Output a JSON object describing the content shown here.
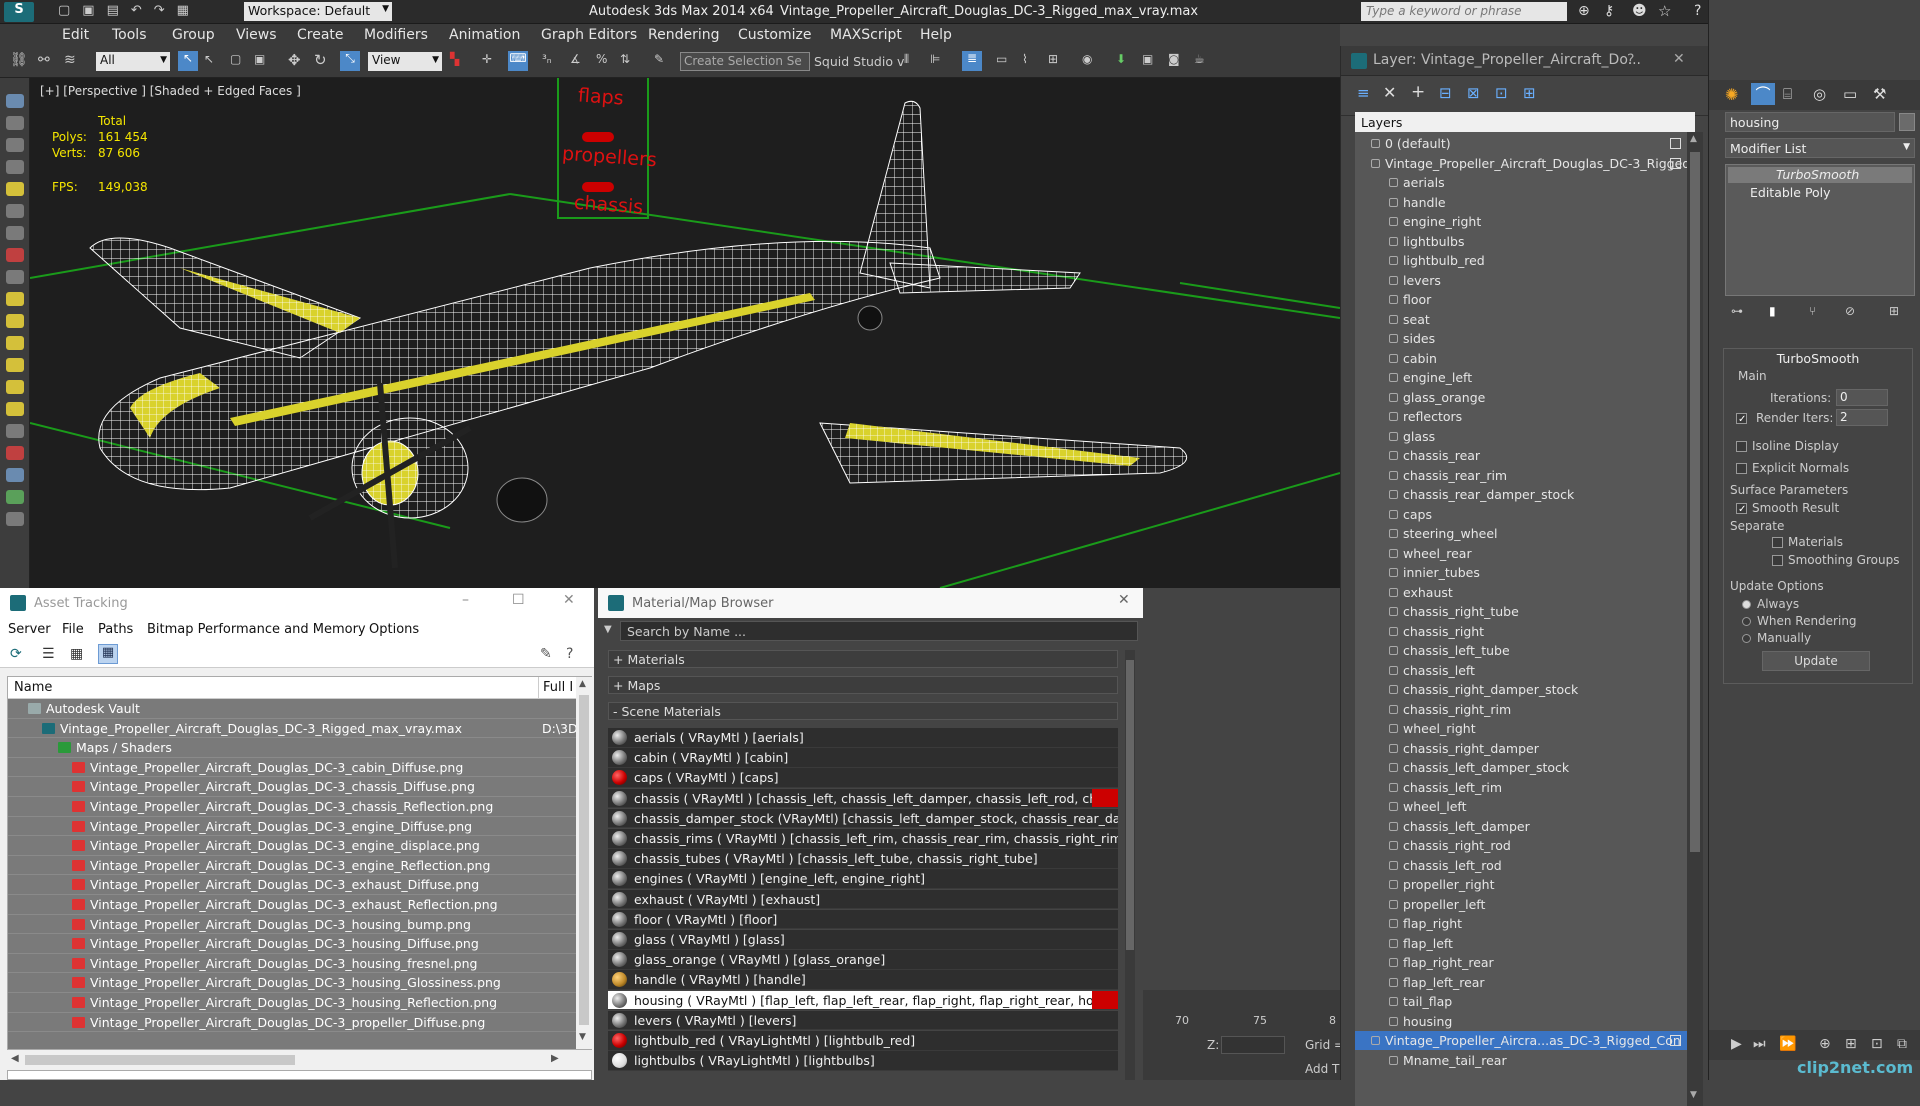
{
  "titlebar": {
    "workspace": "Workspace: Default",
    "app_title": "Autodesk 3ds Max  2014 x64",
    "file_name": "Vintage_Propeller_Aircraft_Douglas_DC-3_Rigged_max_vray.max",
    "search_placeholder": "Type a keyword or phrase"
  },
  "menu": [
    "Edit",
    "Tools",
    "Group",
    "Views",
    "Create",
    "Modifiers",
    "Animation",
    "Graph Editors",
    "Rendering",
    "Customize",
    "MAXScript",
    "Help"
  ],
  "toolbar": {
    "selection_filter": "All",
    "ref_coord": "View",
    "named_selection": "Create Selection Se",
    "squid": "Squid Studio v"
  },
  "viewport": {
    "label": "[+] [Perspective ] [Shaded + Edged Faces ]",
    "stats_header": "Total",
    "polys_label": "Polys:",
    "polys_value": "161 454",
    "verts_label": "Verts:",
    "verts_value": "87 606",
    "fps_label": "FPS:",
    "fps_value": "149,038",
    "controls": [
      "flaps",
      "propellers",
      "chassis"
    ]
  },
  "layers": {
    "title": "Layer: Vintage_Propeller_Aircraft_Do...",
    "help": "?",
    "header": "Layers",
    "default_layer": "0 (default)",
    "root_layer": "Vintage_Propeller_Aircraft_Douglas_DC-3_Rigged",
    "items": [
      "aerials",
      "handle",
      "engine_right",
      "lightbulbs",
      "lightbulb_red",
      "levers",
      "floor",
      "seat",
      "sides",
      "cabin",
      "engine_left",
      "glass_orange",
      "reflectors",
      "glass",
      "chassis_rear",
      "chassis_rear_rim",
      "chassis_rear_damper_stock",
      "caps",
      "steering_wheel",
      "wheel_rear",
      "innier_tubes",
      "exhaust",
      "chassis_right_tube",
      "chassis_right",
      "chassis_left_tube",
      "chassis_left",
      "chassis_right_damper_stock",
      "chassis_right_rim",
      "wheel_right",
      "chassis_right_damper",
      "chassis_left_damper_stock",
      "chassis_left_rim",
      "wheel_left",
      "chassis_left_damper",
      "chassis_right_rod",
      "chassis_left_rod",
      "propeller_right",
      "propeller_left",
      "flap_right",
      "flap_left",
      "flap_right_rear",
      "flap_left_rear",
      "tail_flap",
      "housing"
    ],
    "selected_layer": "Vintage_Propeller_Aircra...as_DC-3_Rigged_Con",
    "last_item": "Mname_tail_rear"
  },
  "command_panel": {
    "object_name": "housing",
    "modifier_list": "Modifier List",
    "stack": [
      "TurboSmooth",
      "Editable Poly"
    ],
    "rollout_title": "TurboSmooth",
    "main_label": "Main",
    "iterations_label": "Iterations:",
    "iterations_value": "0",
    "render_iters_label": "Render Iters:",
    "render_iters_value": "2",
    "isoline": "Isoline Display",
    "explicit_normals": "Explicit Normals",
    "surface_params": "Surface Parameters",
    "smooth_result": "Smooth Result",
    "separate": "Separate",
    "materials": "Materials",
    "smoothing_groups": "Smoothing Groups",
    "update_options": "Update Options",
    "always": "Always",
    "when_rendering": "When Rendering",
    "manually": "Manually",
    "update_button": "Update"
  },
  "asset_tracking": {
    "title": "Asset Tracking",
    "menu": [
      "Server",
      "File",
      "Paths",
      "Bitmap Performance and Memory",
      "Options"
    ],
    "col_name": "Name",
    "col_full": "Full I",
    "vault": "Autodesk Vault",
    "file": "Vintage_Propeller_Aircraft_Douglas_DC-3_Rigged_max_vray.max",
    "file_path": "D:\\3D",
    "maps_folder": "Maps / Shaders",
    "maps": [
      "Vintage_Propeller_Aircraft_Douglas_DC-3_cabin_Diffuse.png",
      "Vintage_Propeller_Aircraft_Douglas_DC-3_chassis_Diffuse.png",
      "Vintage_Propeller_Aircraft_Douglas_DC-3_chassis_Reflection.png",
      "Vintage_Propeller_Aircraft_Douglas_DC-3_engine_Diffuse.png",
      "Vintage_Propeller_Aircraft_Douglas_DC-3_engine_displace.png",
      "Vintage_Propeller_Aircraft_Douglas_DC-3_engine_Reflection.png",
      "Vintage_Propeller_Aircraft_Douglas_DC-3_exhaust_Diffuse.png",
      "Vintage_Propeller_Aircraft_Douglas_DC-3_exhaust_Reflection.png",
      "Vintage_Propeller_Aircraft_Douglas_DC-3_housing_bump.png",
      "Vintage_Propeller_Aircraft_Douglas_DC-3_housing_Diffuse.png",
      "Vintage_Propeller_Aircraft_Douglas_DC-3_housing_fresnel.png",
      "Vintage_Propeller_Aircraft_Douglas_DC-3_housing_Glossiness.png",
      "Vintage_Propeller_Aircraft_Douglas_DC-3_housing_Reflection.png",
      "Vintage_Propeller_Aircraft_Douglas_DC-3_propeller_Diffuse.png"
    ]
  },
  "material_browser": {
    "title": "Material/Map Browser",
    "search_placeholder": "Search by Name ...",
    "sections": [
      "+ Materials",
      "+ Maps",
      "- Scene Materials"
    ],
    "materials": [
      "aerials  ( VRayMtl )  [aerials]",
      "cabin  ( VRayMtl )  [cabin]",
      "caps  ( VRayMtl )  [caps]",
      "chassis  ( VRayMtl ) [chassis_left, chassis_left_damper, chassis_left_rod, chassis...",
      "chassis_damper_stock  (VRayMtl) [chassis_left_damper_stock, chassis_rear_da...",
      "chassis_rims  ( VRayMtl )  [chassis_left_rim, chassis_rear_rim, chassis_right_rim,...",
      "chassis_tubes  ( VRayMtl )  [chassis_left_tube, chassis_right_tube]",
      "engines  ( VRayMtl )  [engine_left, engine_right]",
      "exhaust  ( VRayMtl )  [exhaust]",
      "floor  ( VRayMtl )  [floor]",
      "glass  ( VRayMtl )  [glass]",
      "glass_orange  ( VRayMtl )  [glass_orange]",
      "handle  ( VRayMtl )  [handle]",
      "housing  ( VRayMtl )  [flap_left, flap_left_rear, flap_right, flap_right_rear, housin...",
      "levers  ( VRayMtl )  [levers]",
      "lightbulb_red  ( VRayLightMtl )  [lightbulb_red]",
      "lightbulbs  ( VRayLightMtl )  [lightbulbs]"
    ]
  },
  "timeline": {
    "ticks": [
      "70",
      "75",
      "8"
    ],
    "z_label": "Z:",
    "grid_label": "Grid =",
    "add_t": "Add T"
  },
  "watermark": "clip2net.com"
}
